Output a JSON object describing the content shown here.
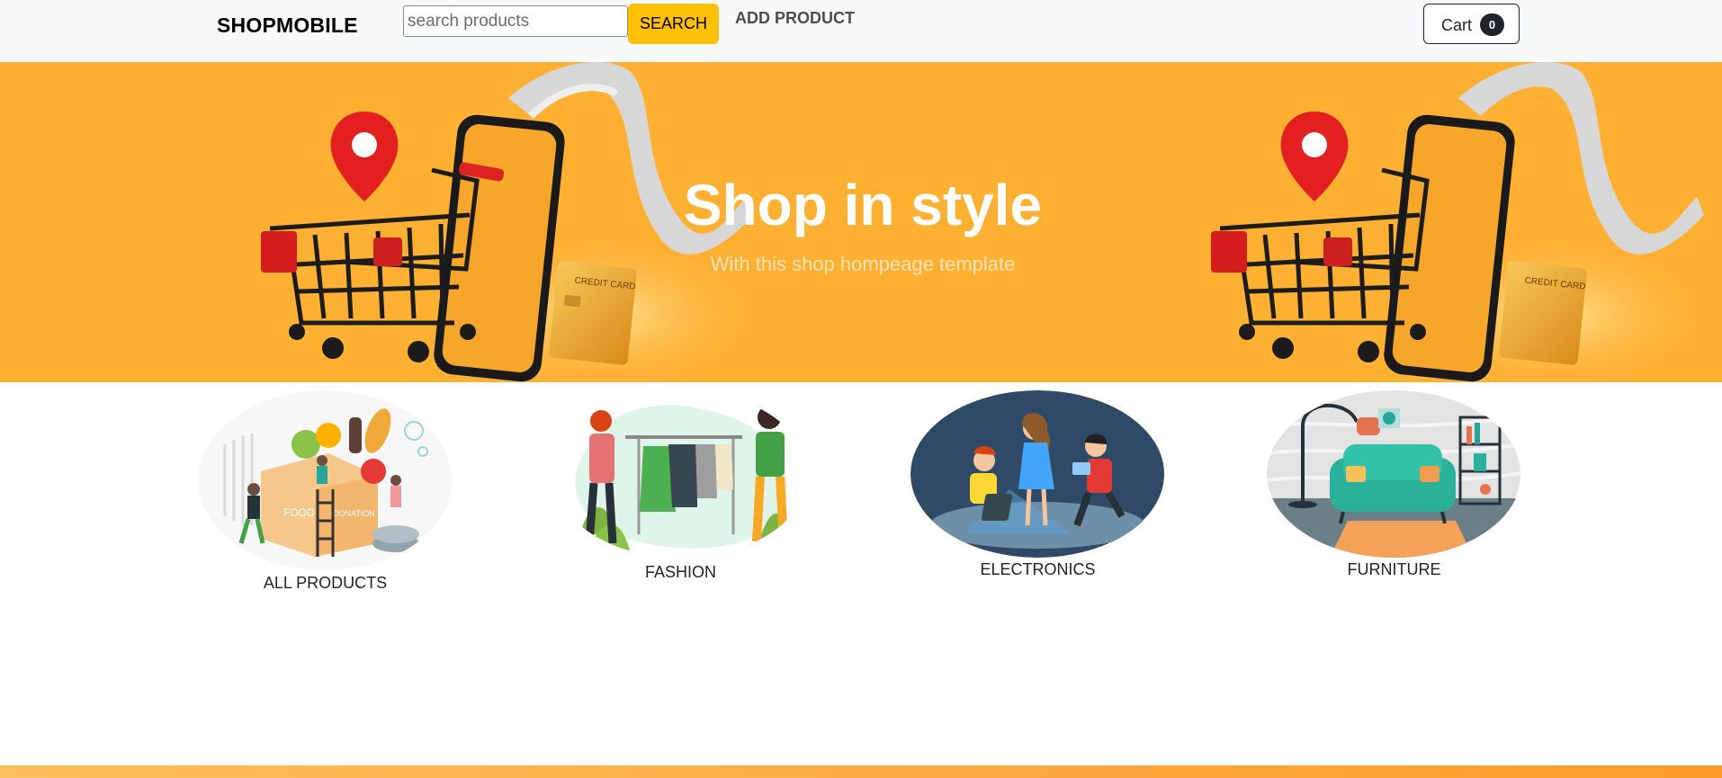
{
  "navbar": {
    "brand": "SHOPMOBILE",
    "search_placeholder": "search products",
    "search_value": "",
    "search_button": "SEARCH",
    "add_product": "ADD PRODUCT",
    "cart_label": "Cart",
    "cart_count": "0"
  },
  "hero": {
    "title": "Shop in style",
    "subtitle": "With this shop hompeage template",
    "credit_card_text": "CREDIT CARD",
    "background_color": "#feb033"
  },
  "categories": [
    {
      "label": "ALL PRODUCTS",
      "icon": "food-donation-illustration",
      "box_text": "FOOD",
      "box_text2": "DONATION"
    },
    {
      "label": "FASHION",
      "icon": "fashion-clothing-rack-illustration"
    },
    {
      "label": "ELECTRONICS",
      "icon": "kids-with-devices-illustration"
    },
    {
      "label": "FURNITURE",
      "icon": "living-room-sofa-illustration"
    }
  ],
  "colors": {
    "accent": "#ffc107",
    "navbar_bg": "#f8f9fa",
    "dark": "#212529"
  }
}
